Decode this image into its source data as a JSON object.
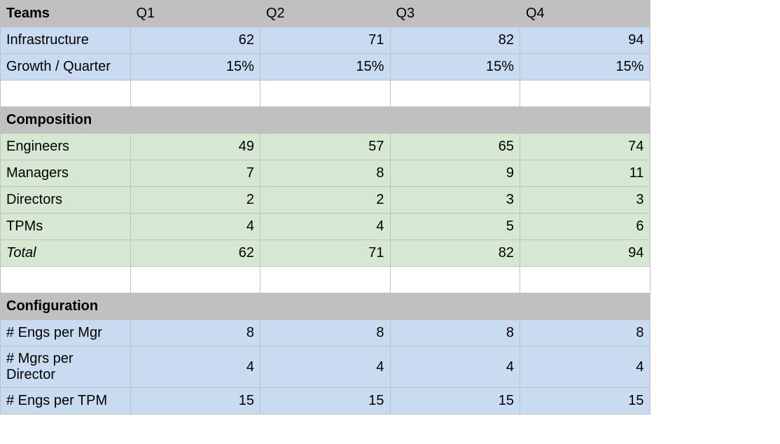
{
  "chart_data": {
    "type": "table",
    "columns": [
      "",
      "Q1",
      "Q2",
      "Q3",
      "Q4"
    ],
    "sections": [
      {
        "header": "Teams",
        "color": "blue",
        "rows": [
          {
            "label": "Infrastructure",
            "values": [
              62,
              71,
              82,
              94
            ]
          },
          {
            "label": "Growth / Quarter",
            "values": [
              "15%",
              "15%",
              "15%",
              "15%"
            ]
          }
        ]
      },
      {
        "header": "Composition",
        "color": "green",
        "rows": [
          {
            "label": "Engineers",
            "values": [
              49,
              57,
              65,
              74
            ]
          },
          {
            "label": "Managers",
            "values": [
              7,
              8,
              9,
              11
            ]
          },
          {
            "label": "Directors",
            "values": [
              2,
              2,
              3,
              3
            ]
          },
          {
            "label": "TPMs",
            "values": [
              4,
              4,
              5,
              6
            ]
          },
          {
            "label": "Total",
            "italic": true,
            "values": [
              62,
              71,
              82,
              94
            ]
          }
        ]
      },
      {
        "header": "Configuration",
        "color": "blue",
        "rows": [
          {
            "label": "# Engs per Mgr",
            "values": [
              8,
              8,
              8,
              8
            ]
          },
          {
            "label": "# Mgrs per Director",
            "values": [
              4,
              4,
              4,
              4
            ]
          },
          {
            "label": "# Engs per TPM",
            "values": [
              15,
              15,
              15,
              15
            ]
          }
        ]
      }
    ]
  },
  "headers": {
    "teams": "Teams",
    "composition": "Composition",
    "configuration": "Configuration",
    "q1": "Q1",
    "q2": "Q2",
    "q3": "Q3",
    "q4": "Q4"
  },
  "rows": {
    "infra": {
      "label": "Infrastructure",
      "q1": "62",
      "q2": "71",
      "q3": "82",
      "q4": "94"
    },
    "growth": {
      "label": "Growth / Quarter",
      "q1": "15%",
      "q2": "15%",
      "q3": "15%",
      "q4": "15%"
    },
    "engineers": {
      "label": "Engineers",
      "q1": "49",
      "q2": "57",
      "q3": "65",
      "q4": "74"
    },
    "managers": {
      "label": "Managers",
      "q1": "7",
      "q2": "8",
      "q3": "9",
      "q4": "11"
    },
    "directors": {
      "label": "Directors",
      "q1": "2",
      "q2": "2",
      "q3": "3",
      "q4": "3"
    },
    "tpms": {
      "label": "TPMs",
      "q1": "4",
      "q2": "4",
      "q3": "5",
      "q4": "6"
    },
    "total": {
      "label": "Total",
      "q1": "62",
      "q2": "71",
      "q3": "82",
      "q4": "94"
    },
    "engsPerMgr": {
      "label": "# Engs per Mgr",
      "q1": "8",
      "q2": "8",
      "q3": "8",
      "q4": "8"
    },
    "mgrsPerDir": {
      "label": "# Mgrs per Director",
      "q1": "4",
      "q2": "4",
      "q3": "4",
      "q4": "4"
    },
    "engsPerTpm": {
      "label": "# Engs per TPM",
      "q1": "15",
      "q2": "15",
      "q3": "15",
      "q4": "15"
    }
  }
}
